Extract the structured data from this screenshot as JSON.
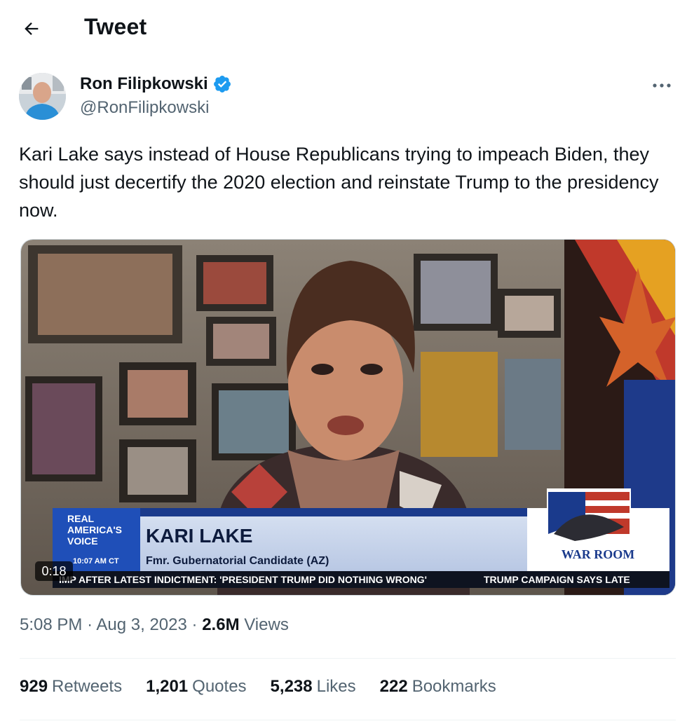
{
  "header": {
    "title": "Tweet"
  },
  "author": {
    "name": "Ron Filipkowski",
    "handle": "@RonFilipkowski",
    "verified_color": "#1d9bf0"
  },
  "tweet": {
    "text": "Kari Lake says instead of House Republicans trying to impeach Biden, they should just decertify the 2020 election and reinstate Trump to the presidency now.",
    "time": "5:08 PM",
    "date": "Aug 3, 2023",
    "views_count": "2.6M",
    "views_label": "Views"
  },
  "video": {
    "duration": "0:18",
    "network": [
      "REAL",
      "AMERICA'S",
      "VOICE"
    ],
    "clock": "10:07 AM CT",
    "lower_third_name": "KARI LAKE",
    "lower_third_title": "Fmr. Gubernatorial Candidate (AZ)",
    "ticker_left": "IMP AFTER LATEST INDICTMENT: 'PRESIDENT TRUMP DID NOTHING WRONG'",
    "ticker_right": "TRUMP CAMPAIGN SAYS LATE",
    "show_logo": "WAR ROOM"
  },
  "stats": [
    {
      "count": "929",
      "label": "Retweets"
    },
    {
      "count": "1,201",
      "label": "Quotes"
    },
    {
      "count": "5,238",
      "label": "Likes"
    },
    {
      "count": "222",
      "label": "Bookmarks"
    }
  ],
  "icons": {
    "back": "arrow-left-icon",
    "more": "more-horizontal-icon",
    "verified": "verified-badge-icon"
  }
}
